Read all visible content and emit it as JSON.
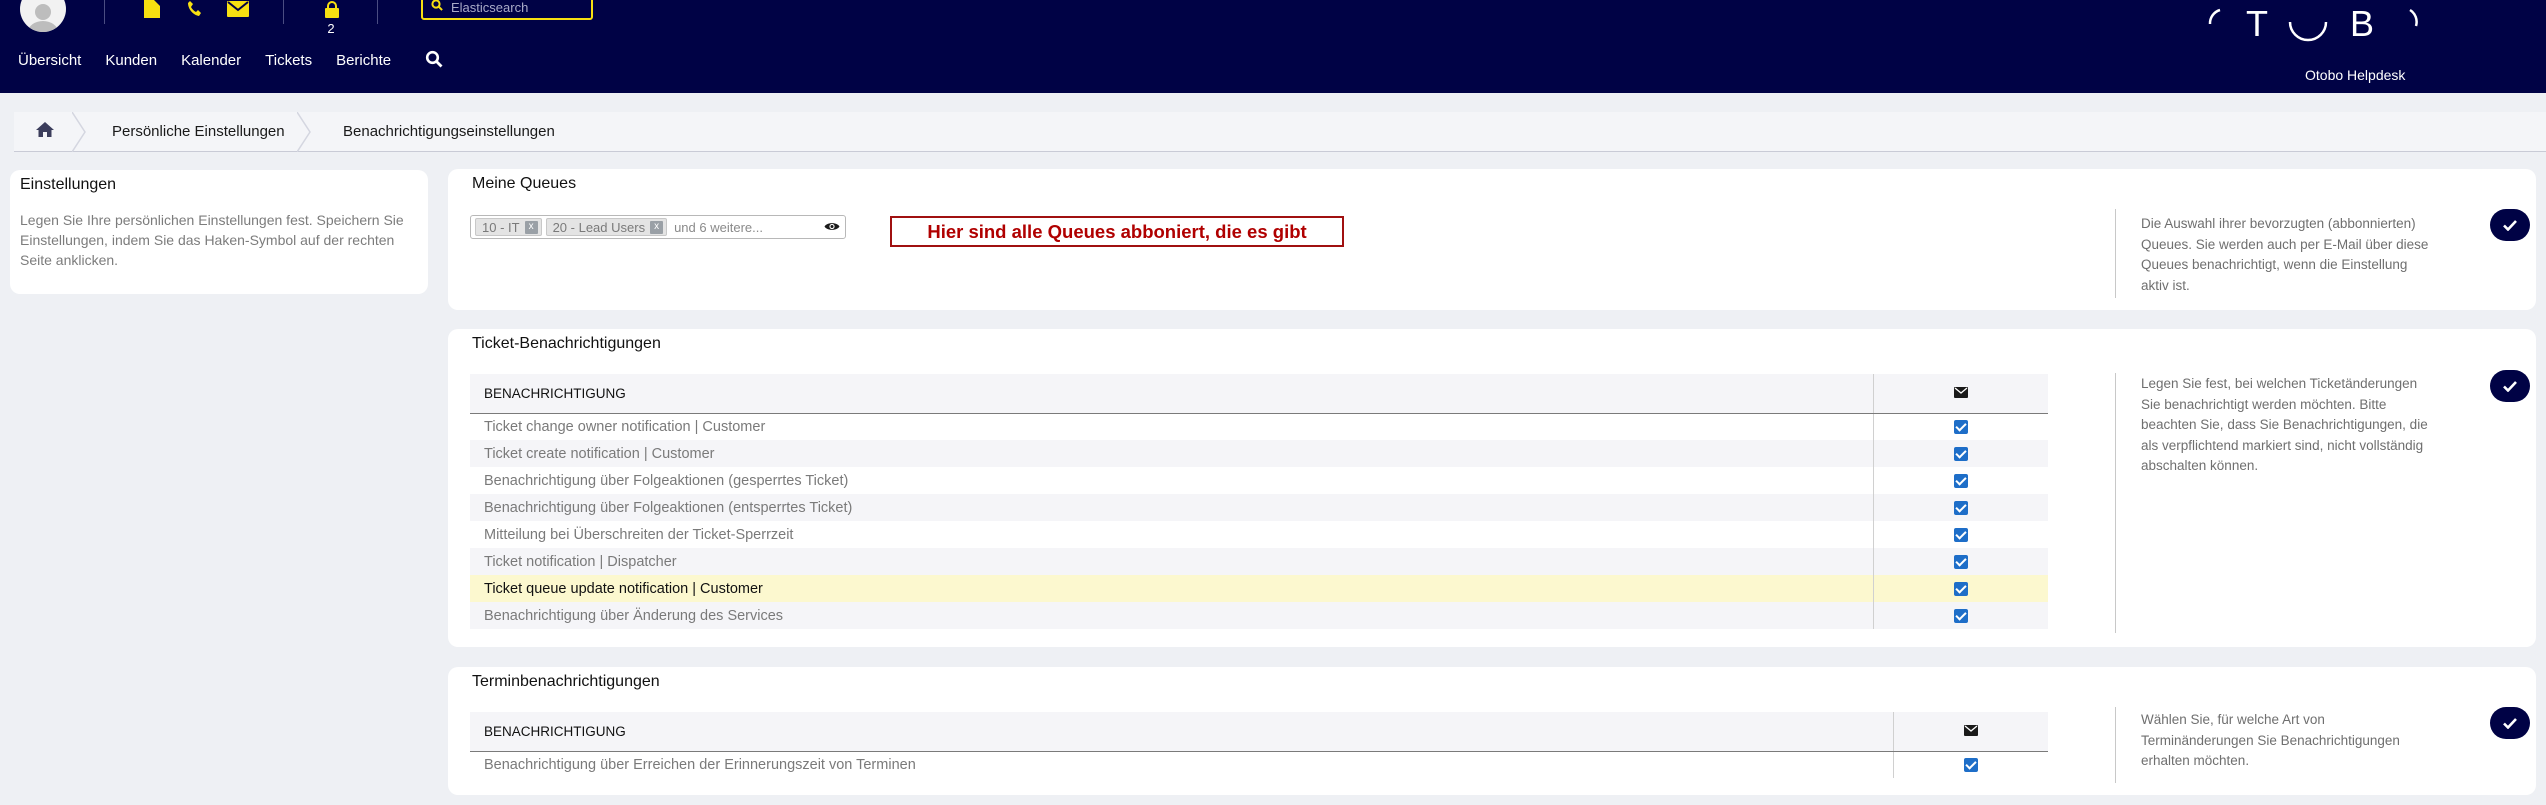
{
  "header": {
    "search_placeholder": "Elasticsearch",
    "locked_tickets_count": "2",
    "nav": [
      "Übersicht",
      "Kunden",
      "Kalender",
      "Tickets",
      "Berichte"
    ],
    "product_name": "Otobo Helpdesk",
    "logo_letters": [
      "T",
      "B"
    ],
    "accent_color": "#f7e011",
    "background_color": "#000245"
  },
  "breadcrumb": {
    "items": [
      "Persönliche Einstellungen",
      "Benachrichtigungseinstellungen"
    ]
  },
  "sidebar": {
    "title": "Einstellungen",
    "text": "Legen Sie Ihre persönlichen Einstellungen fest. Speichern Sie Einstellungen, indem Sie das Haken-Symbol auf der rechten Seite anklicken."
  },
  "queues": {
    "title": "Meine Queues",
    "selected": [
      "10 - IT",
      "20 - Lead Users"
    ],
    "remove_label": "x",
    "more_label": "und 6 weitere...",
    "annotation": "Hier sind alle Queues abboniert, die es gibt",
    "description": "Die Auswahl ihrer bevorzugten (abbonnierten) Queues. Sie werden auch per E-Mail über diese Queues benachrichtigt, wenn die Einstellung aktiv ist."
  },
  "ticket_notifications": {
    "title": "Ticket-Benachrichtigungen",
    "column_header": "BENACHRICHTIGUNG",
    "rows": [
      {
        "label": "Ticket change owner notification | Customer",
        "checked": true
      },
      {
        "label": "Ticket create notification | Customer",
        "checked": true
      },
      {
        "label": "Benachrichtigung über Folgeaktionen (gesperrtes Ticket)",
        "checked": true
      },
      {
        "label": "Benachrichtigung über Folgeaktionen (entsperrtes Ticket)",
        "checked": true
      },
      {
        "label": "Mitteilung bei Überschreiten der Ticket-Sperrzeit",
        "checked": true
      },
      {
        "label": "Ticket notification | Dispatcher",
        "checked": true
      },
      {
        "label": "Ticket queue update notification | Customer",
        "checked": true
      },
      {
        "label": "Benachrichtigung über Änderung des Services",
        "checked": true
      }
    ],
    "description": "Legen Sie fest, bei welchen Ticketänderungen Sie benachrichtigt werden möchten. Bitte beachten Sie, dass Sie Benachrichtigungen, die als verpflichtend markiert sind, nicht vollständig abschalten können."
  },
  "appointment_notifications": {
    "title": "Terminbenachrichtigungen",
    "column_header": "BENACHRICHTIGUNG",
    "rows": [
      {
        "label": "Benachrichtigung über Erreichen der Erinnerungszeit von Terminen",
        "checked": true
      }
    ],
    "description": "Wählen Sie, für welche Art von Terminänderungen Sie Benachrichtigungen erhalten möchten."
  }
}
